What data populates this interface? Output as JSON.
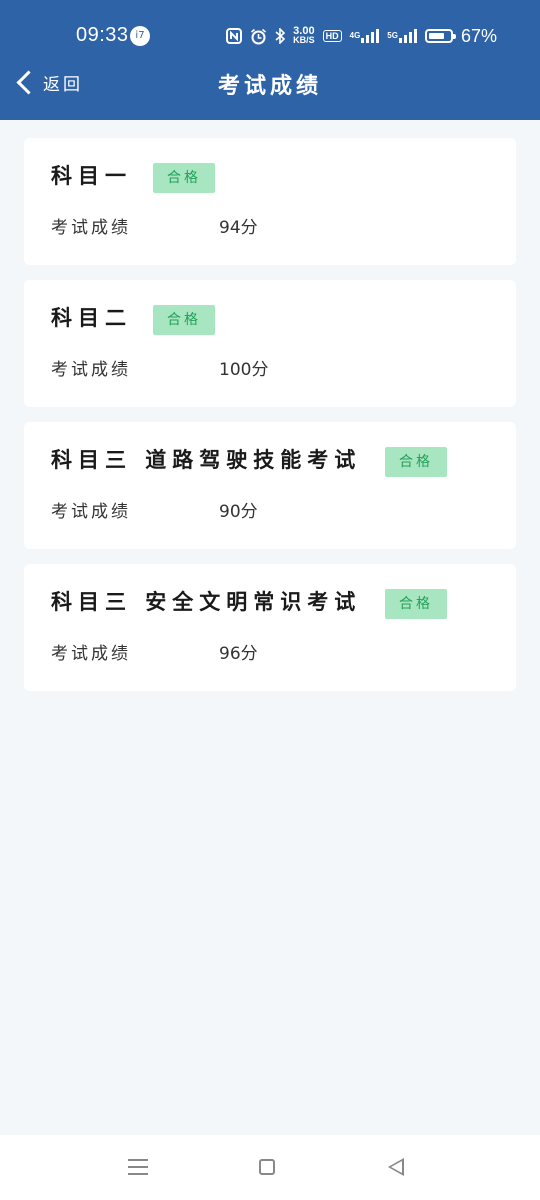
{
  "status_bar": {
    "time": "09:33",
    "notification": "i7",
    "speed_top": "3.00",
    "speed_bottom": "KB/S",
    "hd": "HD",
    "net1": "4G",
    "net2": "5G",
    "battery": "67%"
  },
  "header": {
    "back_label": "返回",
    "title": "考试成绩"
  },
  "cards": [
    {
      "title": "科目一",
      "badge": "合格",
      "score_label": "考试成绩",
      "score": "94分"
    },
    {
      "title": "科目二",
      "badge": "合格",
      "score_label": "考试成绩",
      "score": "100分"
    },
    {
      "title": "科目三 道路驾驶技能考试",
      "badge": "合格",
      "score_label": "考试成绩",
      "score": "90分"
    },
    {
      "title": "科目三 安全文明常识考试",
      "badge": "合格",
      "score_label": "考试成绩",
      "score": "96分"
    }
  ],
  "colors": {
    "header_bg": "#2f63a8",
    "page_bg": "#f4f7f9",
    "badge_bg": "#a8e6c1",
    "badge_text": "#25a05a"
  },
  "bottom_nav": {
    "icons": [
      "menu-icon",
      "home-icon",
      "back-icon"
    ]
  }
}
